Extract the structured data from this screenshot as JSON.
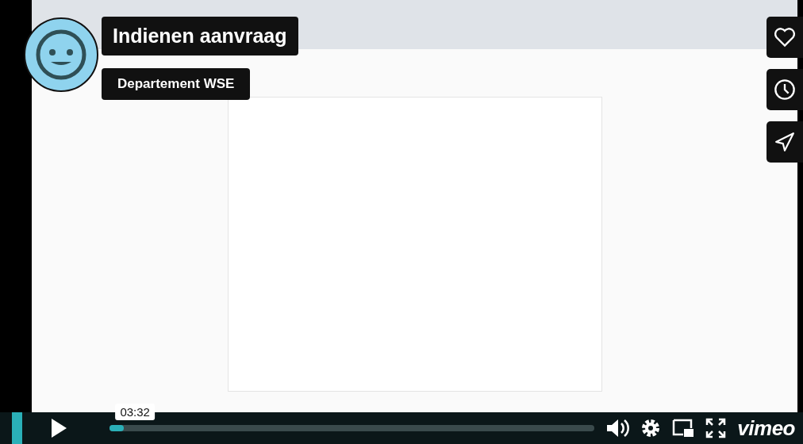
{
  "video": {
    "title": "Indienen aanvraag",
    "byline": "Departement WSE"
  },
  "side_buttons": [
    {
      "kind": "like"
    },
    {
      "kind": "watch_later"
    },
    {
      "kind": "share"
    }
  ],
  "controls": {
    "playing": false,
    "time_tooltip": "03:32",
    "progress": {
      "level": 0.03
    },
    "brand": "vimeo"
  }
}
